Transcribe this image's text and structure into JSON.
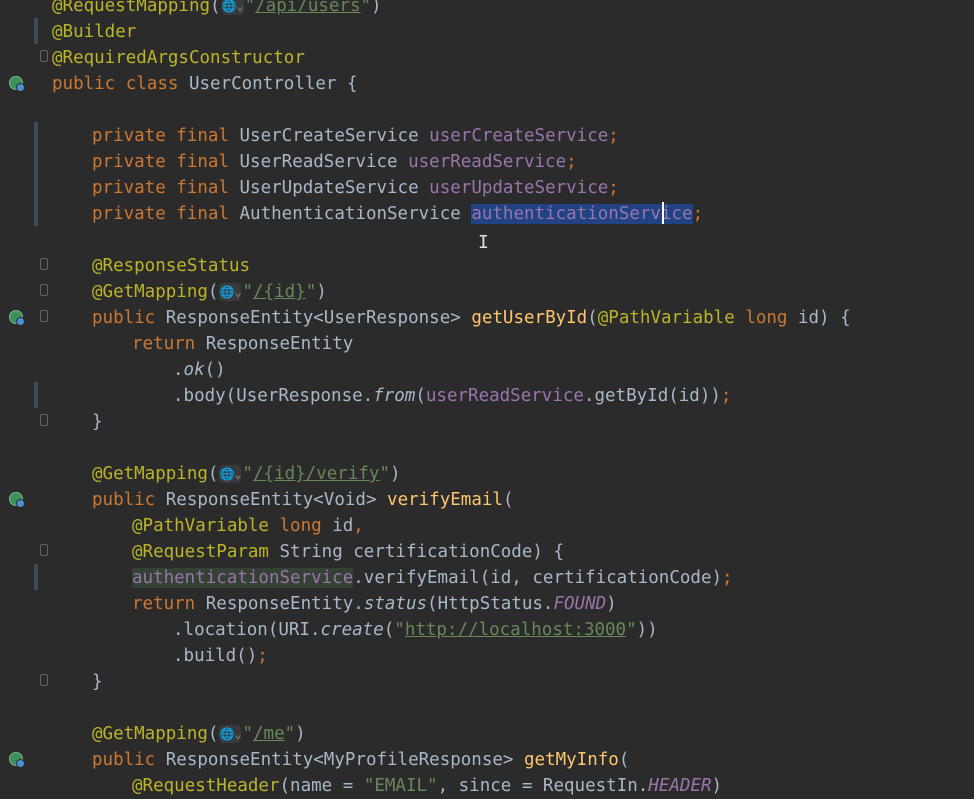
{
  "code": {
    "l0": {
      "ann": "@RequestMapping",
      "open": "(",
      "globe": "🌐⌄",
      "q1": "\"",
      "url": "/api/users",
      "q2": "\"",
      "close": ")"
    },
    "l1": {
      "ann": "@Builder"
    },
    "l2": {
      "ann": "@RequiredArgsConstructor"
    },
    "l3": {
      "kw": "public class ",
      "name": "UserController {"
    },
    "l5": {
      "kw": "private final ",
      "type": "UserCreateService ",
      "field": "userCreateService",
      "semi": ";"
    },
    "l6": {
      "kw": "private final ",
      "type": "UserReadService ",
      "field": "userReadService",
      "semi": ";"
    },
    "l7": {
      "kw": "private final ",
      "type": "UserUpdateService ",
      "field": "userUpdateService",
      "semi": ";"
    },
    "l8": {
      "kw": "private final ",
      "type": "AuthenticationService ",
      "field": "authenticationService",
      "semi": ";"
    },
    "l10": {
      "ann": "@ResponseStatus"
    },
    "l11": {
      "ann": "@GetMapping",
      "open": "(",
      "globe": "🌐⌄",
      "q1": "\"",
      "url": "/{id}",
      "q2": "\"",
      "close": ")"
    },
    "l12": {
      "kw": "public ",
      "t1": "ResponseEntity<UserResponse> ",
      "fn": "getUserById",
      "p1": "(",
      "ann": "@PathVariable ",
      "kw2": "long ",
      "rest": "id) {"
    },
    "l13": {
      "kw": "return ",
      "rest": "ResponseEntity"
    },
    "l14": {
      "dot": ".",
      "m": "ok",
      "rest": "()"
    },
    "l15": {
      "a": ".body(UserResponse.",
      "m": "from",
      "b": "(",
      "fld": "userReadService",
      "c": ".getById(id))",
      "semi": ";"
    },
    "l16": {
      "text": "}"
    },
    "l18": {
      "ann": "@GetMapping",
      "open": "(",
      "globe": "🌐⌄",
      "q1": "\"",
      "url": "/{id}/verify",
      "q2": "\"",
      "close": ")"
    },
    "l19": {
      "kw": "public ",
      "t1": "ResponseEntity<Void> ",
      "fn": "verifyEmail",
      "rest": "("
    },
    "l20": {
      "ann": "@PathVariable ",
      "kw": "long ",
      "rest": "id",
      "comma": ","
    },
    "l21": {
      "ann": "@RequestParam ",
      "rest": "String certificationCode) {"
    },
    "l22": {
      "fld": "authenticationService",
      "rest": ".verifyEmail(id, certificationCode)",
      "semi": ";"
    },
    "l23": {
      "kw": "return ",
      "a": "ResponseEntity.",
      "m": "status",
      "b": "(HttpStatus.",
      "const": "FOUND",
      "c": ")"
    },
    "l24": {
      "a": ".location(URI.",
      "m": "create",
      "b": "(",
      "q1": "\"",
      "url": "http://localhost:3000",
      "q2": "\"",
      "c": "))"
    },
    "l25": {
      "a": ".build()",
      "semi": ";"
    },
    "l26": {
      "text": "}"
    },
    "l28": {
      "ann": "@GetMapping",
      "open": "(",
      "globe": "🌐⌄",
      "q1": "\"",
      "url": "/me",
      "q2": "\"",
      "close": ")"
    },
    "l29": {
      "kw": "public ",
      "t1": "ResponseEntity<MyProfileResponse> ",
      "fn": "getMyInfo",
      "rest": "("
    },
    "l30": {
      "ann": "@RequestHeader",
      "rest": "(name = ",
      "str": "\"EMAIL\"",
      "rest2": ", since = RequestIn.",
      "const": "HEADER",
      ")": ")"
    }
  },
  "colors": {
    "background": "#2b2b2b",
    "keyword": "#cc7832",
    "annotation": "#bbb529",
    "field": "#9876aa",
    "method": "#ffc66d",
    "string": "#6a8759",
    "selection": "#214283"
  },
  "icons": {
    "run": "run-gutter-icon",
    "fold": "fold-marker-icon",
    "globe": "web-endpoint-icon",
    "cursor": "text-cursor-icon"
  }
}
